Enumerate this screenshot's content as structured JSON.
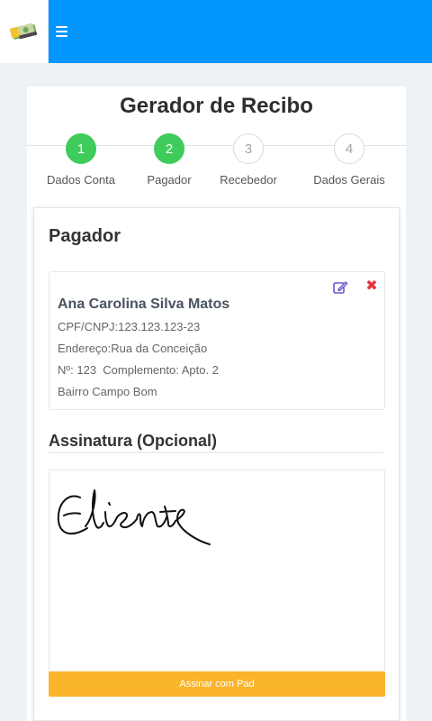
{
  "header": {
    "logo_icon": "money-logo-icon",
    "menu_icon": "hamburger-menu-icon",
    "bar_color": "#0396fe"
  },
  "page": {
    "title": "Gerador de Recibo"
  },
  "stepper": {
    "steps": [
      {
        "number": "1",
        "label": "Dados Conta",
        "state": "completed"
      },
      {
        "number": "2",
        "label": "Pagador",
        "state": "completed"
      },
      {
        "number": "3",
        "label": "Recebedor",
        "state": "pending"
      },
      {
        "number": "4",
        "label": "Dados Gerais",
        "state": "pending"
      }
    ],
    "completed_color": "#3fcc5c"
  },
  "payer_section": {
    "heading": "Pagador",
    "card": {
      "name": "Ana Carolina Silva Matos",
      "document": "CPF/CNPJ:123.123.123-23",
      "address": "Endereço:Rua da Conceição",
      "number_complement": "Nº: 123  Complemento: Apto. 2",
      "district": "Bairro Campo Bom",
      "edit_icon": "edit-icon",
      "delete_icon": "delete-x-icon",
      "delete_glyph": "✖"
    }
  },
  "signature": {
    "heading": "Assinatura (Opcional)",
    "button_label": "Assinar com Pad",
    "button_color": "#fbb52b"
  }
}
